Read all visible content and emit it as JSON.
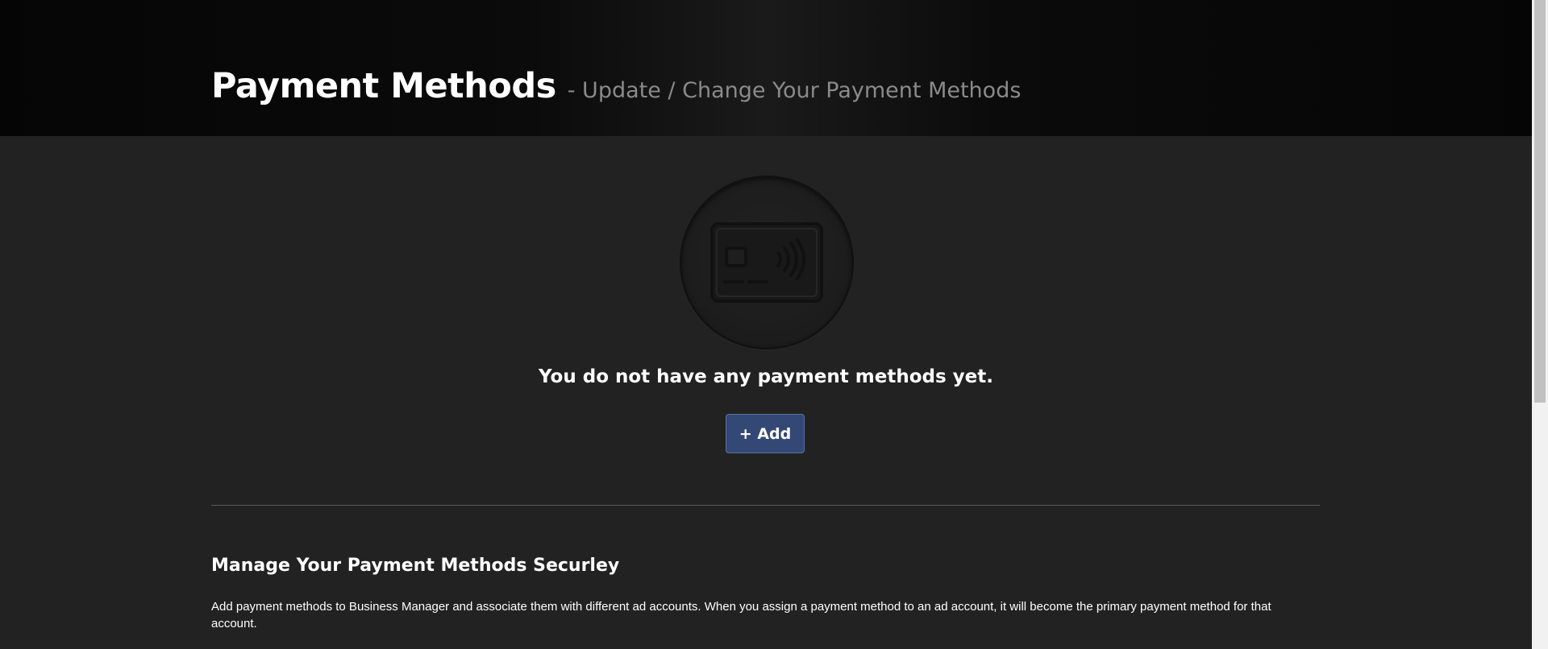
{
  "header": {
    "title": "Payment Methods",
    "subtitle": "- Update / Change Your Payment Methods"
  },
  "empty_state": {
    "icon": "credit-card-contactless-icon",
    "message": "You do not have any payment methods yet.",
    "add_label": "+ Add"
  },
  "section": {
    "title": "Manage Your Payment Methods Securley",
    "body": "Add payment methods to Business Manager and associate them with different ad accounts. When you assign a payment method to an ad account, it will become the primary payment method for that account."
  },
  "colors": {
    "background": "#222222",
    "header_background": "#0a0a0a",
    "button": "#344875",
    "subtitle": "#8a8a8a"
  }
}
